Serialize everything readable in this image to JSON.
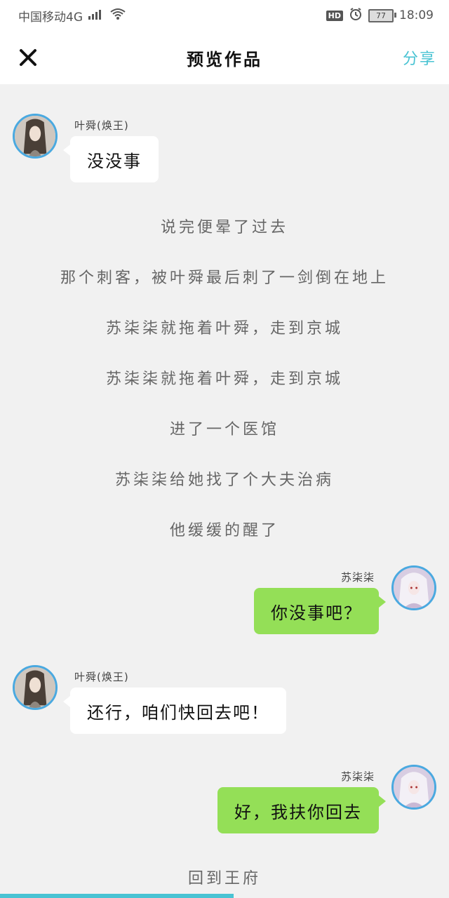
{
  "status": {
    "carrier": "中国移动4G",
    "network": "4G",
    "hd": "HD",
    "battery": "77",
    "time": "18:09"
  },
  "nav": {
    "close_icon": "close-icon",
    "title": "预览作品",
    "share": "分享"
  },
  "chat": {
    "m1": {
      "name": "叶舜(焕王)",
      "text": "没没事"
    },
    "narr": [
      "说完便晕了过去",
      "那个刺客，被叶舜最后刺了一剑倒在地上",
      "苏柒柒就拖着叶舜，走到京城",
      "苏柒柒就拖着叶舜，走到京城",
      "进了一个医馆",
      "苏柒柒给她找了个大夫治病",
      "他缓缓的醒了"
    ],
    "m2": {
      "name": "苏柒柒",
      "text": "你没事吧？"
    },
    "m3": {
      "name": "叶舜(焕王)",
      "text": "还行，咱们快回去吧！"
    },
    "m4": {
      "name": "苏柒柒",
      "text": "好，我扶你回去"
    },
    "narr_end": "回到王府"
  },
  "progress": {
    "fraction": 0.52
  },
  "colors": {
    "accent": "#49c3d3",
    "right_bubble": "#94df57",
    "avatar_border": "#4aa9e0"
  }
}
